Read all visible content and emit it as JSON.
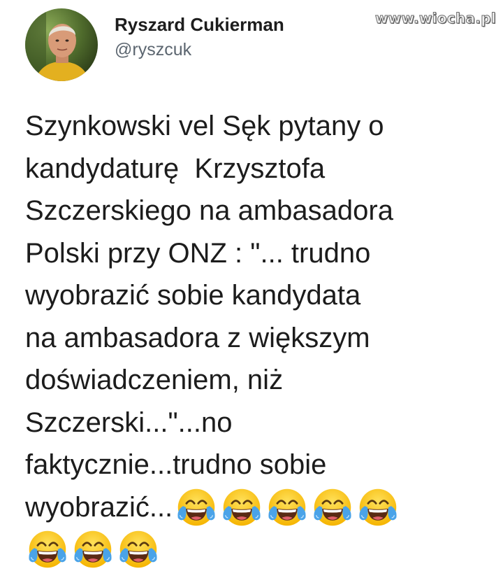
{
  "watermark": "www.wiocha.pl",
  "tweet": {
    "author_name": "Ryszard Cukierman",
    "author_handle": "@ryszcuk",
    "lines": [
      "Szynkowski vel Sęk pytany o",
      "kandydaturę  Krzysztofa",
      "Szczerskiego na ambasadora",
      "Polski przy ONZ : \"... trudno",
      "wyobrazić sobie kandydata",
      "na ambasadora z większym",
      "doświadczeniem, niż",
      "Szczerski...\"...no",
      "faktycznie...trudno sobie",
      "wyobrazić..."
    ],
    "emoji_name": "face-with-tears-of-joy-icon",
    "emoji_count_inline": 5,
    "emoji_count_next_line": 3
  }
}
